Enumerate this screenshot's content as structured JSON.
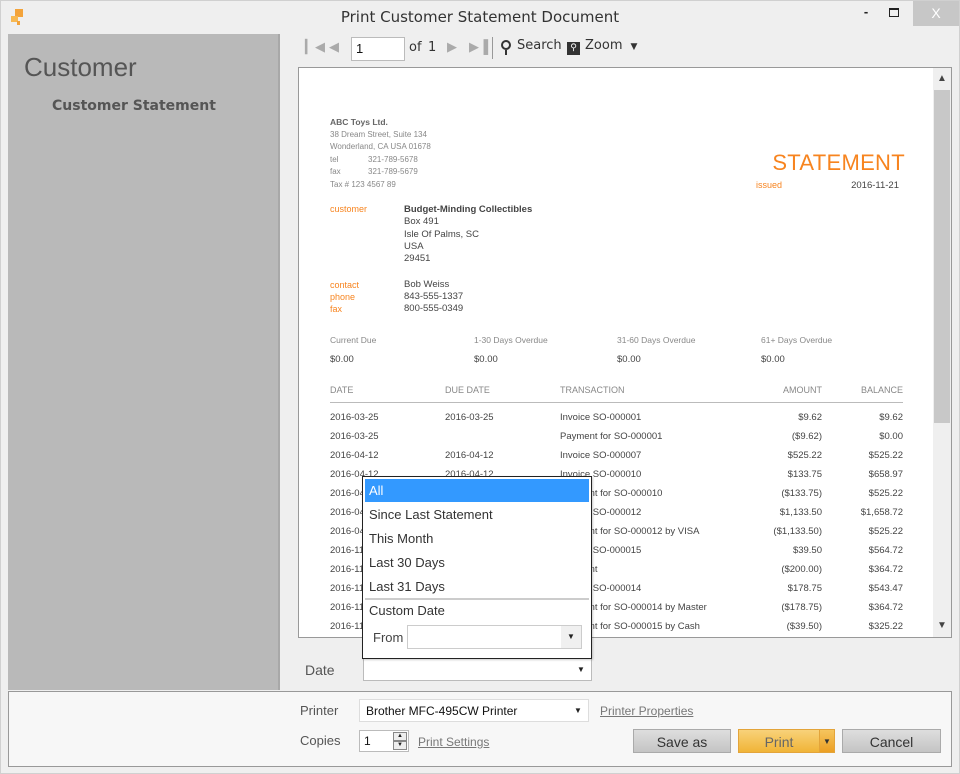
{
  "window": {
    "title": "Print Customer Statement Document",
    "controls": {
      "minimize": "-",
      "maximize": "maximize",
      "close": "X"
    }
  },
  "sidebar": {
    "title": "Customer",
    "items": [
      {
        "label": "Customer Statement"
      }
    ]
  },
  "toolbar": {
    "page_value": "1",
    "of_label": "of",
    "total_pages": "1",
    "search_label": "Search",
    "zoom_label": "Zoom",
    "icons": [
      "first-page-icon",
      "prev-page-icon",
      "next-page-icon",
      "last-page-icon",
      "search-icon",
      "zoom-icon",
      "chevron-down-icon"
    ]
  },
  "document": {
    "company": {
      "name": "ABC Toys Ltd.",
      "address1": "38 Dream Street, Suite 134",
      "address2": "Wonderland, CA USA 01678",
      "tel_label": "tel",
      "tel": "321-789-5678",
      "fax_label": "fax",
      "fax": "321-789-5679",
      "tax": "Tax # 123 4567 89"
    },
    "title": "STATEMENT",
    "issued_label": "issued",
    "issued_date": "2016-11-21",
    "customer_label": "customer",
    "customer": {
      "name": "Budget-Minding Collectibles",
      "line1": "Box 491",
      "line2": "Isle Of Palms, SC",
      "line3": "USA",
      "line4": "29451"
    },
    "contact_labels": {
      "contact": "contact",
      "phone": "phone",
      "fax": "fax"
    },
    "contact": {
      "name": "Bob Weiss",
      "phone": "843-555-1337",
      "fax": "800-555-0349"
    },
    "aging": [
      {
        "label": "Current Due",
        "value": "$0.00"
      },
      {
        "label": "1-30 Days Overdue",
        "value": "$0.00"
      },
      {
        "label": "31-60 Days Overdue",
        "value": "$0.00"
      },
      {
        "label": "61+ Days Overdue",
        "value": "$0.00"
      }
    ],
    "table": {
      "headers": [
        "DATE",
        "DUE DATE",
        "TRANSACTION",
        "AMOUNT",
        "BALANCE"
      ],
      "rows": [
        [
          "2016-03-25",
          "2016-03-25",
          "Invoice SO-000001",
          "$9.62",
          "$9.62"
        ],
        [
          "2016-03-25",
          "",
          "Payment for SO-000001",
          "($9.62)",
          "$0.00"
        ],
        [
          "2016-04-12",
          "2016-04-12",
          "Invoice SO-000007",
          "$525.22",
          "$525.22"
        ],
        [
          "2016-04-12",
          "2016-04-12",
          "Invoice SO-000010",
          "$133.75",
          "$658.97"
        ],
        [
          "2016-04",
          "",
          "Payment for SO-000010",
          "($133.75)",
          "$525.22"
        ],
        [
          "2016-04",
          "",
          "Invoice SO-000012",
          "$1,133.50",
          "$1,658.72"
        ],
        [
          "2016-04",
          "",
          "Payment for SO-000012 by VISA",
          "($1,133.50)",
          "$525.22"
        ],
        [
          "2016-11",
          "",
          "Invoice SO-000015",
          "$39.50",
          "$564.72"
        ],
        [
          "2016-11",
          "",
          "Payment",
          "($200.00)",
          "$364.72"
        ],
        [
          "2016-11",
          "",
          "Invoice SO-000014",
          "$178.75",
          "$543.47"
        ],
        [
          "2016-11",
          "",
          "Payment for SO-000014 by Master",
          "($178.75)",
          "$364.72"
        ],
        [
          "2016-11",
          "",
          "Payment for SO-000015 by Cash",
          "($39.50)",
          "$325.22"
        ]
      ]
    }
  },
  "date_filter": {
    "label": "Date",
    "value": "",
    "options": [
      "All",
      "Since Last Statement",
      "This Month",
      "Last 30 Days",
      "Last 31 Days"
    ],
    "selected": "All",
    "custom_label": "Custom Date",
    "from_label": "From",
    "from_value": ""
  },
  "print": {
    "printer_label": "Printer",
    "printer_value": "Brother MFC-495CW Printer",
    "printer_properties_link": "Printer Properties",
    "copies_label": "Copies",
    "copies_value": "1",
    "print_settings_link": "Print Settings",
    "save_as_label": "Save as",
    "print_label": "Print",
    "cancel_label": "Cancel"
  },
  "colors": {
    "accent_orange": "#f7841f",
    "selection_blue": "#3399ff",
    "print_button": "#f0b437",
    "sidebar_bg": "#b9b9b9"
  }
}
